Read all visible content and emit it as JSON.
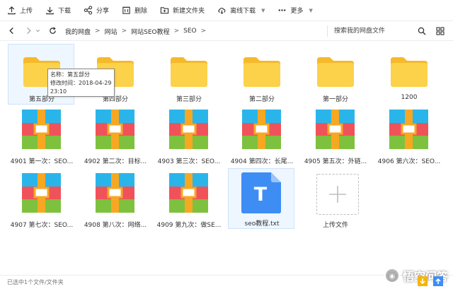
{
  "toolbar": {
    "upload": "上传",
    "download": "下载",
    "share": "分享",
    "delete": "删除",
    "new_folder": "新建文件夹",
    "offline_download": "离线下载",
    "more": "更多"
  },
  "breadcrumb": [
    "我的网盘",
    "网站",
    "网站SEO教程",
    "SEO"
  ],
  "search": {
    "placeholder": "搜索我的网盘文件"
  },
  "folders": [
    "第五部分",
    "第四部分",
    "第三部分",
    "第二部分",
    "第一部分",
    "1200"
  ],
  "archives": [
    "4901 第一次：SEO...",
    "4902 第二次：目标...",
    "4903 第三次：SEO...",
    "4904 第四次：长尾...",
    "4905 第五次：外链...",
    "4906 第六次：SEO...",
    "4907 第七次：SEO...",
    "4908 第八次：网络...",
    "4909 第九次：做SE..."
  ],
  "text_file": {
    "name": "seo教程.txt",
    "glyph": "T"
  },
  "upload_tile": {
    "label": "上传文件"
  },
  "tooltip": {
    "name": "名称：第五部分",
    "modified": "修改时间：2018-04-29",
    "time": "23:10"
  },
  "status": {
    "text": "已选中1个文件/文件夹"
  },
  "watermark": {
    "text": "悟空问答"
  },
  "colors": {
    "folder": "#fcd24a",
    "folder_back": "#f5b92b",
    "archive_blue": "#2ab5ea",
    "archive_red": "#f0525a",
    "archive_green": "#7ec13e",
    "archive_strap": "#f6a823",
    "txt_blue": "#3d8df5",
    "selection": "#eef6ff"
  }
}
